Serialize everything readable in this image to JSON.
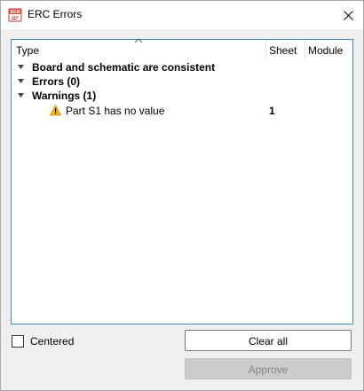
{
  "window": {
    "title": "ERC Errors",
    "app_icon": "schematic-app-icon",
    "close_icon": "close-icon"
  },
  "columns": {
    "type": "Type",
    "sheet": "Sheet",
    "module": "Module"
  },
  "tree": {
    "consistent": "Board and schematic are consistent",
    "errors": "Errors (0)",
    "warnings": "Warnings (1)",
    "warning_item": {
      "label": "Part S1 has no value",
      "sheet": "1",
      "icon": "warning-icon"
    }
  },
  "options": {
    "centered_label": "Centered",
    "centered_checked": false
  },
  "buttons": {
    "clear_all": "Clear all",
    "approve": "Approve"
  },
  "colors": {
    "accent_border": "#3c8cc8",
    "warning": "#f2b200"
  }
}
